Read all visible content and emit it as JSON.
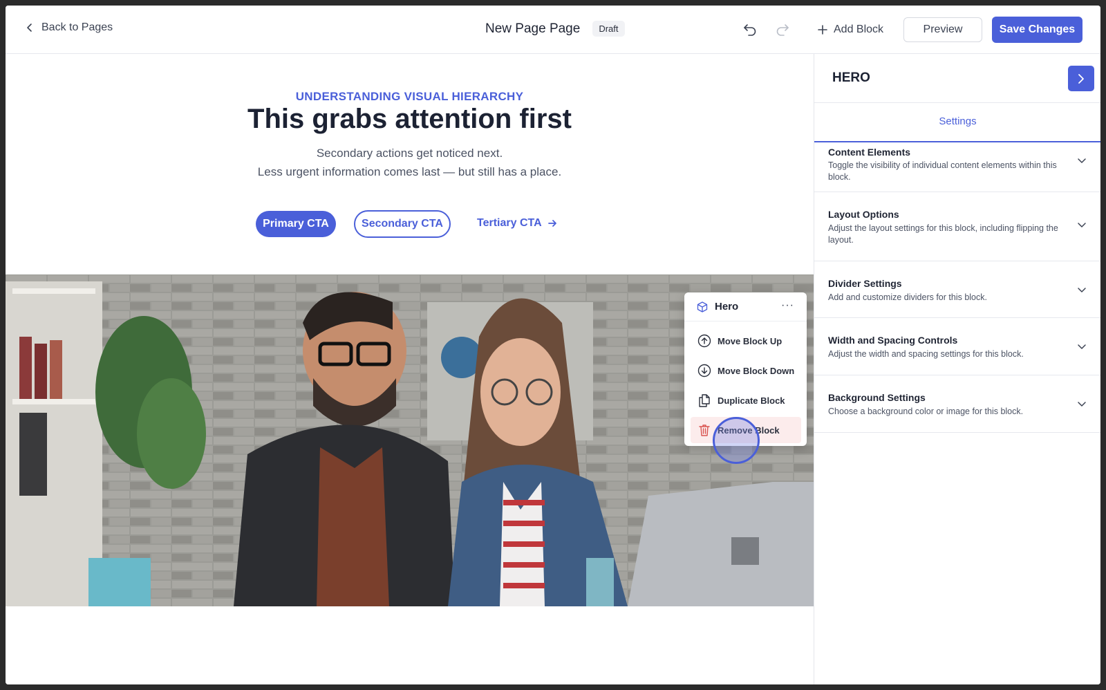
{
  "topbar": {
    "back_label": "Back to Pages",
    "page_title": "New Page Page",
    "status_badge": "Draft",
    "add_block_label": "Add Block",
    "preview_label": "Preview",
    "save_label": "Save Changes"
  },
  "hero": {
    "eyebrow": "UNDERSTANDING VISUAL HIERARCHY",
    "headline": "This grabs attention first",
    "subtext_line1": "Secondary actions get noticed next.",
    "subtext_line2": "Less urgent information comes last — but still has a place.",
    "primary_cta": "Primary CTA",
    "secondary_cta": "Secondary CTA",
    "tertiary_cta": "Tertiary CTA",
    "image_icon": "photo-two-people-at-laptop"
  },
  "block_menu": {
    "title": "Hero",
    "more_label": "···",
    "items": [
      {
        "label": "Move Block Up",
        "icon": "arrow-up-circle-icon"
      },
      {
        "label": "Move Block Down",
        "icon": "arrow-down-circle-icon"
      },
      {
        "label": "Duplicate Block",
        "icon": "copy-icon"
      },
      {
        "label": "Remove Block",
        "icon": "trash-icon"
      }
    ]
  },
  "panel": {
    "title": "HERO",
    "tab": "Settings",
    "sections": [
      {
        "title": "Content Elements",
        "desc": "Toggle the visibility of individual content elements within this block."
      },
      {
        "title": "Layout Options",
        "desc": "Adjust the layout settings for this block, including flipping the layout."
      },
      {
        "title": "Divider Settings",
        "desc": "Add and customize dividers for this block."
      },
      {
        "title": "Width and Spacing Controls",
        "desc": "Adjust the width and spacing settings for this block."
      },
      {
        "title": "Background Settings",
        "desc": "Choose a background color or image for this block."
      }
    ]
  },
  "colors": {
    "accent": "#4a5fd9",
    "danger_bg": "#fcecec",
    "danger_icon": "#d9534f"
  }
}
